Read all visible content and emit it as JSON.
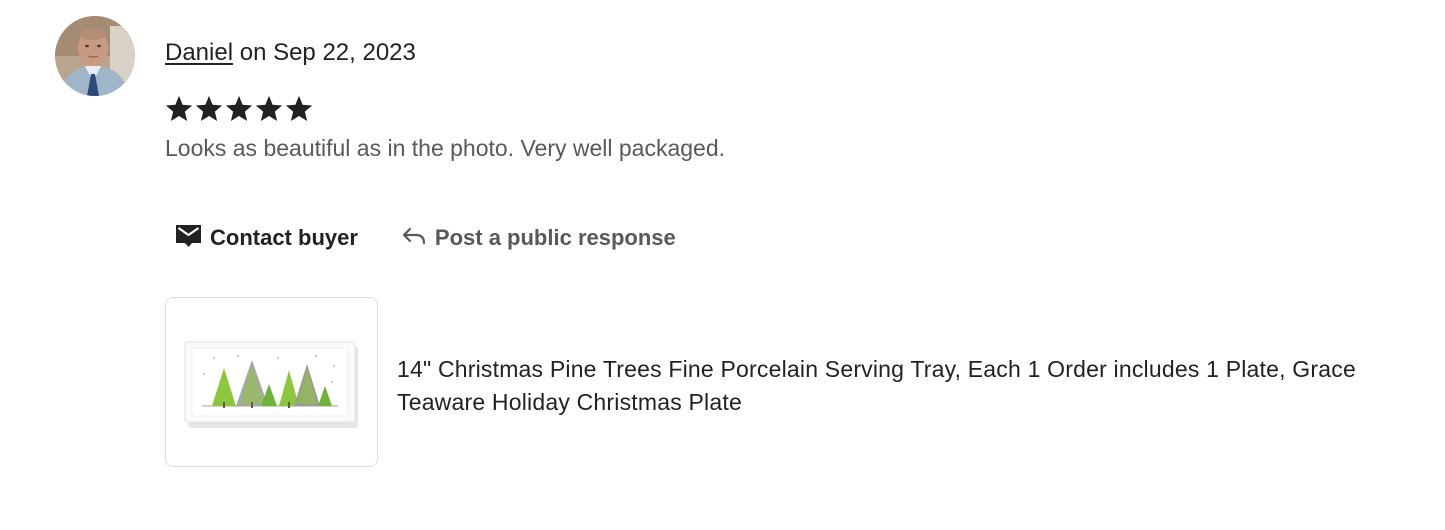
{
  "review": {
    "reviewer_name": "Daniel",
    "date_text": " on Sep 22, 2023",
    "rating": 5,
    "rating_max": 5,
    "text": "Looks as beautiful as in the photo. Very well packaged."
  },
  "actions": {
    "contact_label": "Contact buyer",
    "response_label": "Post a public response"
  },
  "product": {
    "title": "14\" Christmas Pine Trees Fine Porcelain Serving Tray, Each 1 Order includes 1 Plate, Grace Teaware Holiday Christmas Plate"
  },
  "icons": {
    "contact": "envelope-icon",
    "response": "reply-arrow-icon",
    "star": "star-icon"
  },
  "colors": {
    "text_primary": "#222222",
    "text_secondary": "#595959",
    "star": "#222222",
    "border": "#dcdcdc"
  }
}
